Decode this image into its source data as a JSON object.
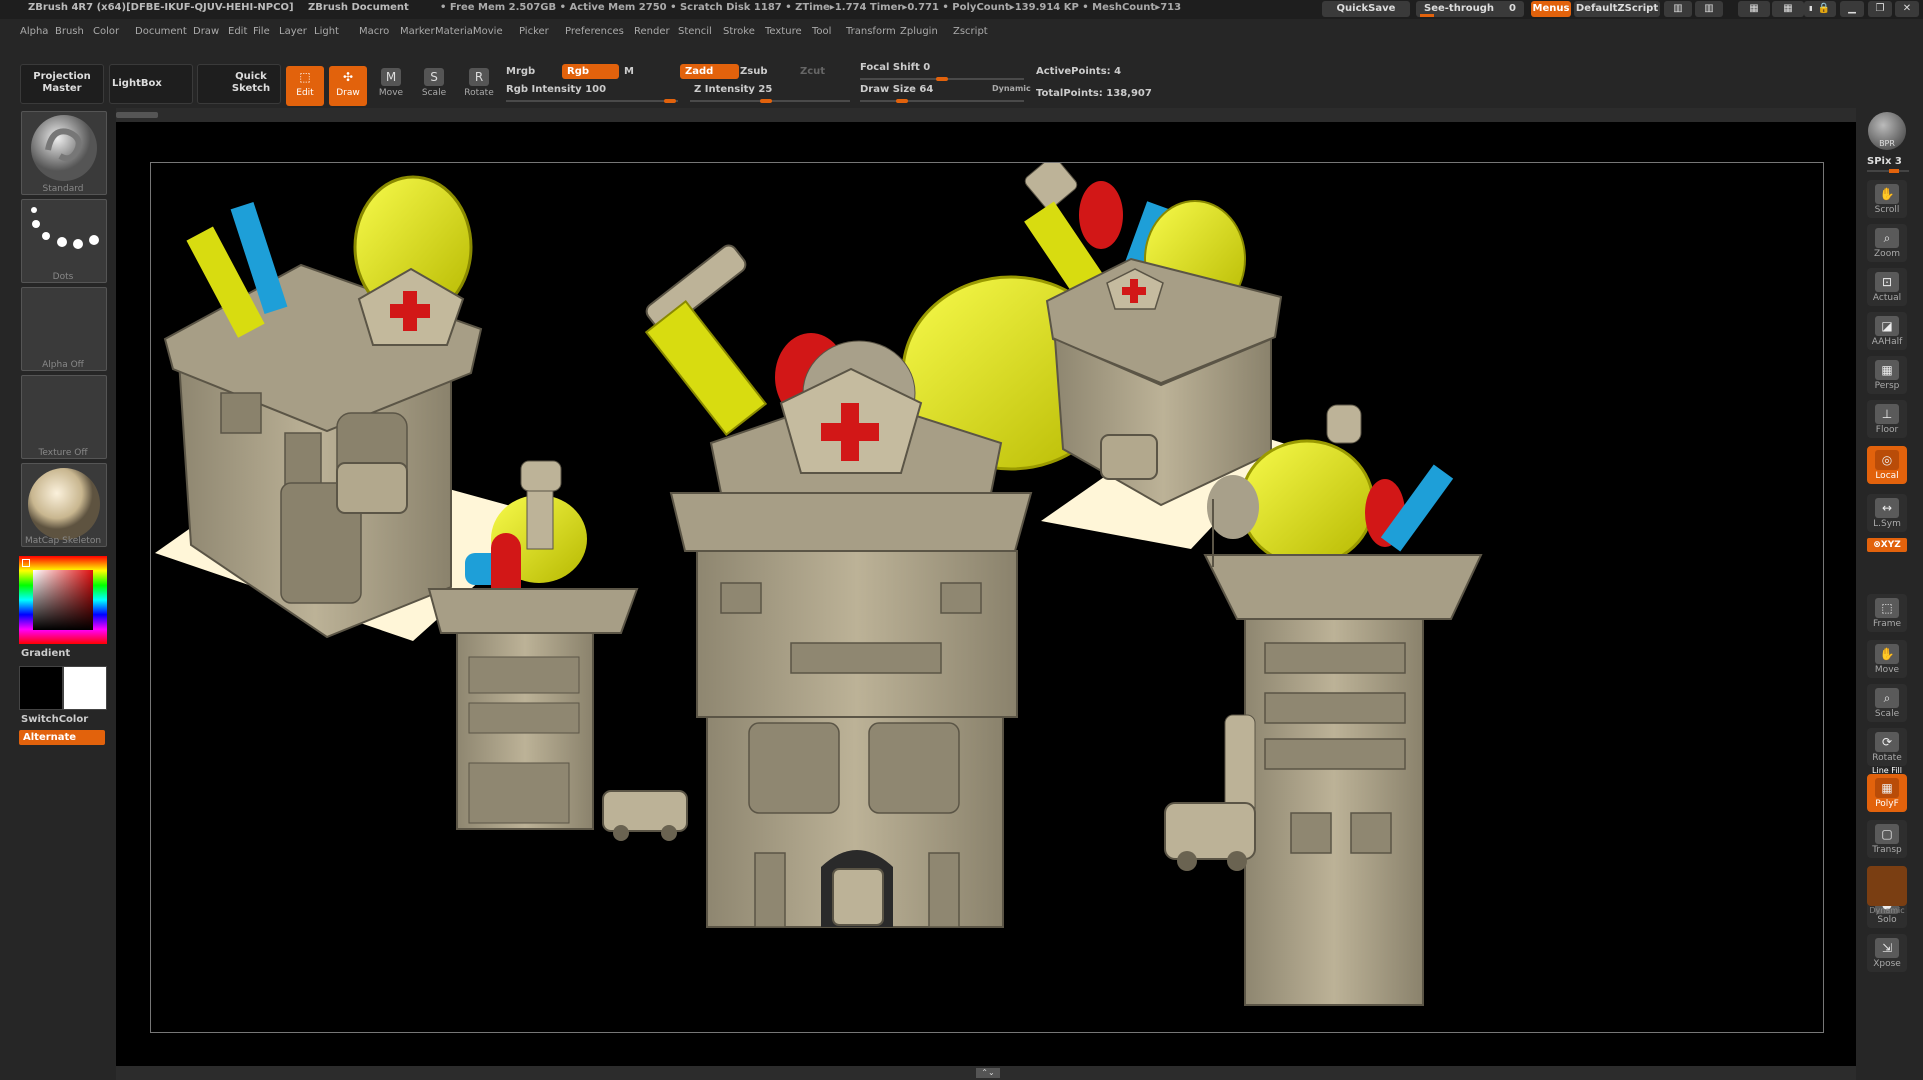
{
  "titlebar": {
    "app": "ZBrush 4R7 (x64)[DFBE-IKUF-QJUV-HEHI-NPCO]",
    "document": "ZBrush Document",
    "stats": "• Free Mem 2.507GB • Active Mem 2750 • Scratch Disk 1187 • ZTime▸1.774 Timer▸0.771 • PolyCount▸139.914 KP • MeshCount▸713",
    "quicksave": "QuickSave",
    "seethrough": "See-through",
    "seethrough_value": "0",
    "menus": "Menus",
    "script": "DefaultZScript"
  },
  "menubar": [
    "Alpha",
    "Brush",
    "Color",
    "Document",
    "Draw",
    "Edit",
    "File",
    "Layer",
    "Light",
    "Macro",
    "Marker",
    "Material",
    "Movie",
    "Picker",
    "Preferences",
    "Render",
    "Stencil",
    "Stroke",
    "Texture",
    "Tool",
    "Transform",
    "Zplugin",
    "Zscript"
  ],
  "toolbar": {
    "projection_master": "Projection Master",
    "lightbox": "LightBox",
    "quick_sketch": "Quick Sketch",
    "edit": "Edit",
    "draw": "Draw",
    "move": "Move",
    "scale": "Scale",
    "rotate": "Rotate",
    "mrgb": "Mrgb",
    "rgb": "Rgb",
    "m": "M",
    "rgb_intensity_label": "Rgb Intensity",
    "rgb_intensity_value": "100",
    "zadd": "Zadd",
    "zsub": "Zsub",
    "zcut": "Zcut",
    "z_intensity_label": "Z Intensity",
    "z_intensity_value": "25",
    "focal_shift_label": "Focal Shift",
    "focal_shift_value": "0",
    "draw_size_label": "Draw Size",
    "draw_size_value": "64",
    "dynamic": "Dynamic",
    "active_points_label": "ActivePoints:",
    "active_points_value": "4",
    "total_points_label": "TotalPoints:",
    "total_points_value": "138,907"
  },
  "left_shelf": {
    "brush": "Standard",
    "stroke": "Dots",
    "alpha": "Alpha Off",
    "texture": "Texture Off",
    "material": "MatCap Skeleton",
    "gradient": "Gradient",
    "switch_color": "SwitchColor",
    "alternate": "Alternate"
  },
  "right_shelf": {
    "bpr": "BPR",
    "spix_label": "SPix",
    "spix_value": "3",
    "items": [
      "Scroll",
      "Zoom",
      "Actual",
      "AAHalf",
      "Persp",
      "Floor",
      "Local",
      "L.Sym",
      "Frame",
      "Move",
      "Scale",
      "Rotate",
      "PolyF",
      "Transp",
      "Solo",
      "Xpose"
    ],
    "xyz": "⊗XYZ",
    "dynamic": "Dynamic",
    "line_fill": "Line Fill"
  },
  "colors": {
    "accent": "#e2620c",
    "model": "#b5ab90",
    "yellow": "#e6ea00",
    "red": "#d21717",
    "blue": "#1ea0d8",
    "plane": "#fff6d8"
  }
}
